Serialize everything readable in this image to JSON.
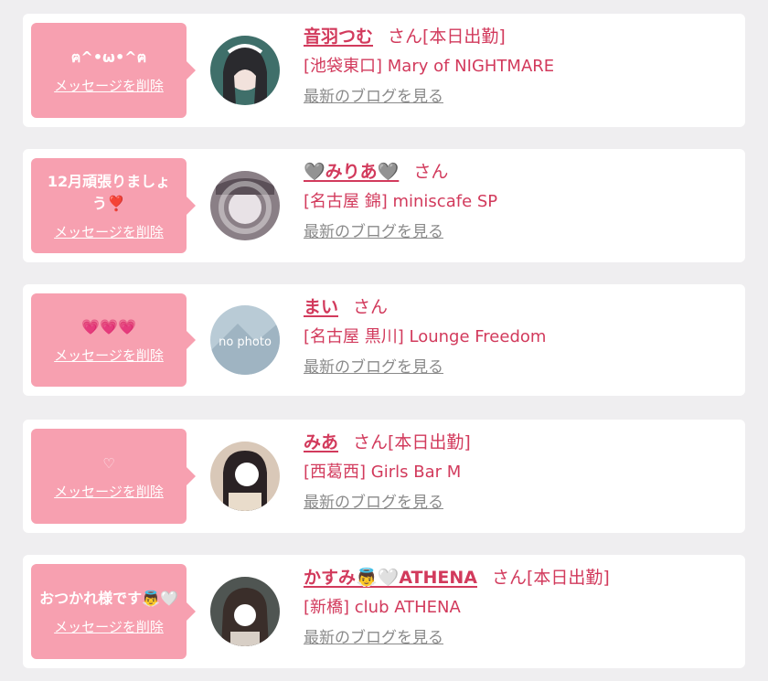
{
  "entries": [
    {
      "message": "ฅ^•ω•^ฅ",
      "delete_label": "メッセージを削除",
      "name": "音羽つむ",
      "suffix": "さん[本日出勤]",
      "shop": "[池袋東口] Mary of NIGHTMARE",
      "blog_label": "最新のブログを見る"
    },
    {
      "message": "12月頑張りましょう❣️",
      "delete_label": "メッセージを削除",
      "name": "🩶みりあ🩶",
      "suffix": "さん",
      "shop": "[名古屋 錦] miniscafe SP",
      "blog_label": "最新のブログを見る"
    },
    {
      "message": "💗💗💗",
      "delete_label": "メッセージを削除",
      "name": "まい",
      "suffix": "さん",
      "shop": "[名古屋 黒川] Lounge Freedom",
      "blog_label": "最新のブログを見る",
      "avatar_text": "no photo"
    },
    {
      "message": "♡",
      "delete_label": "メッセージを削除",
      "name": "みあ",
      "suffix": "さん[本日出勤]",
      "shop": "[西葛西] Girls Bar M",
      "blog_label": "最新のブログを見る"
    },
    {
      "message": "おつかれ様です👼🤍",
      "delete_label": "メッセージを削除",
      "name": "かすみ👼🤍ATHENA",
      "suffix": "さん[本日出勤]",
      "shop": "[新橋] club ATHENA",
      "blog_label": "最新のブログを見る"
    }
  ],
  "colors": {
    "accent": "#d23a5c",
    "bubble": "#f7a0b0",
    "page_bg": "#efeef0",
    "link_gray": "#8a8a8a"
  }
}
